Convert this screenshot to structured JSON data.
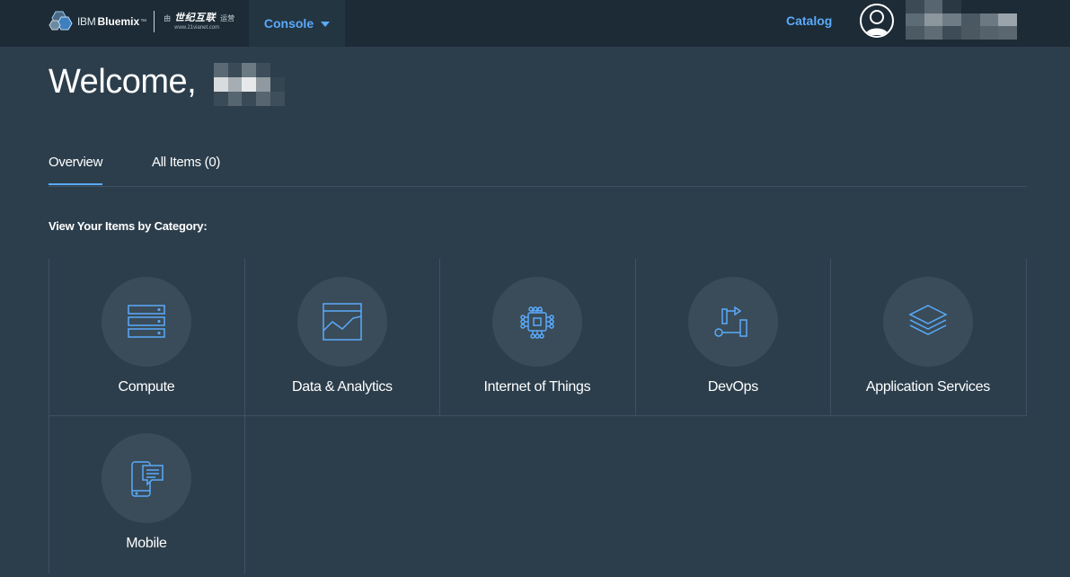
{
  "header": {
    "brand_ibm": "IBM",
    "brand_bluemix": "Bluemix",
    "brand_tm": "™",
    "partner_by": "由",
    "partner_name": "世纪互联",
    "partner_operated": "运营",
    "partner_url": "www.21vianet.com",
    "console_label": "Console",
    "catalog_label": "Catalog",
    "accent_color": "#5aaafa"
  },
  "welcome": {
    "greeting": "Welcome,"
  },
  "tabs": [
    {
      "label": "Overview",
      "active": true
    },
    {
      "label": "All Items (0)",
      "active": false
    }
  ],
  "section_label": "View Your Items by Category:",
  "categories": [
    {
      "label": "Compute",
      "icon": "server-stack-icon"
    },
    {
      "label": "Data & Analytics",
      "icon": "chart-icon"
    },
    {
      "label": "Internet of Things",
      "icon": "chip-icon"
    },
    {
      "label": "DevOps",
      "icon": "pipeline-icon"
    },
    {
      "label": "Application Services",
      "icon": "layers-icon"
    },
    {
      "label": "Mobile",
      "icon": "mobile-chat-icon"
    }
  ]
}
